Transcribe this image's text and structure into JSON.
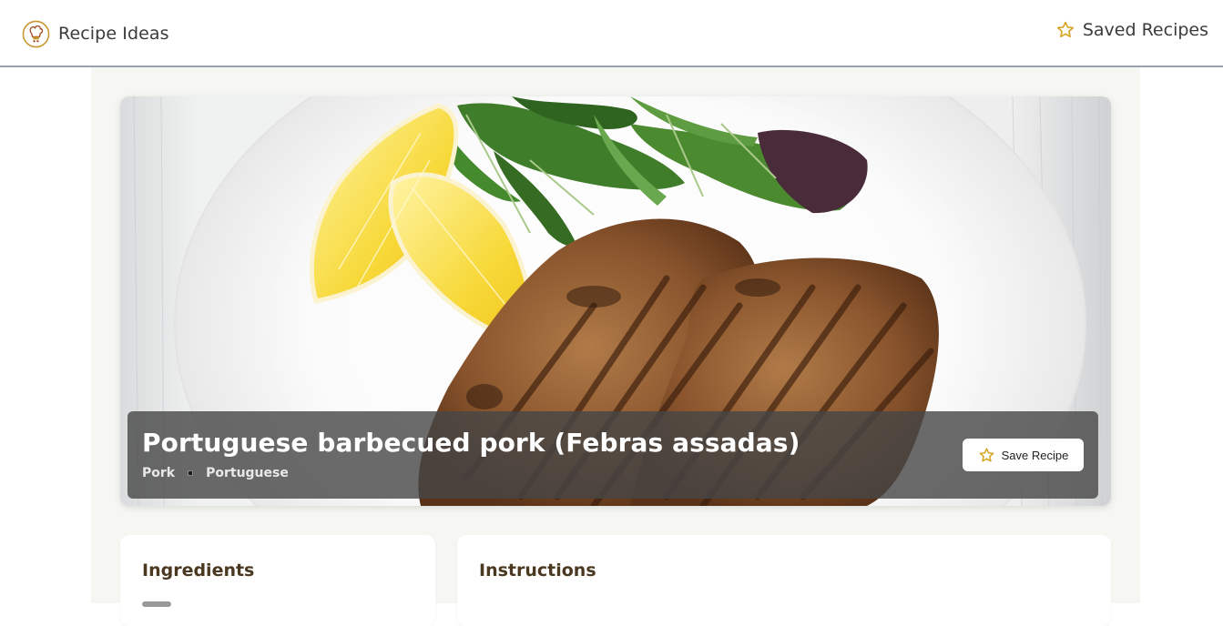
{
  "header": {
    "brand_title": "Recipe Ideas",
    "logo_icon": "chef-hat-logo-icon",
    "saved_label": "Saved Recipes",
    "saved_icon": "star-outline-icon",
    "accent_color": "#d4a017"
  },
  "recipe": {
    "title": "Portuguese barbecued pork (Febras assadas)",
    "tags": [
      "Pork",
      "Portuguese"
    ],
    "save_label": "Save Recipe",
    "save_icon": "star-outline-icon"
  },
  "sections": {
    "ingredients_heading": "Ingredients",
    "instructions_heading": "Instructions"
  }
}
